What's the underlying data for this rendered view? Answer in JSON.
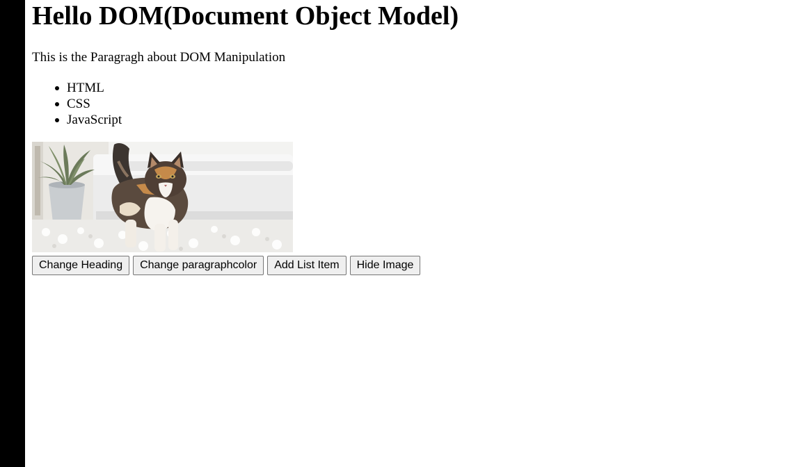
{
  "page": {
    "heading": "Hello DOM(Document Object Model)",
    "paragraph": "This is the Paragragh about DOM Manipulation",
    "list_items": [
      "HTML",
      "CSS",
      "JavaScript"
    ],
    "image": {
      "subject": "cat-photo"
    }
  },
  "controls": {
    "change_heading_label": "Change Heading",
    "change_paragraph_color_label": "Change paragraphcolor",
    "add_list_item_label": "Add List Item",
    "hide_image_label": "Hide Image"
  },
  "colors": {
    "left_bar": "#000000",
    "button_bg": "#efefef",
    "button_border": "#767676",
    "text": "#000000"
  }
}
